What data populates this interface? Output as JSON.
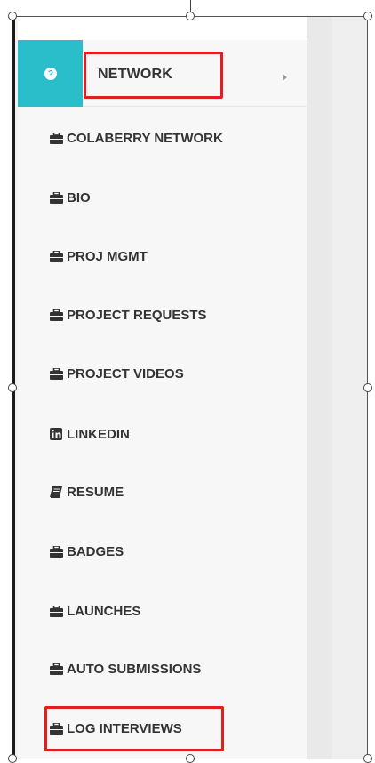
{
  "menu": {
    "header": {
      "label": "NETWORK",
      "icon": "question-circle-icon"
    },
    "items": [
      {
        "label": "COLABERRY NETWORK",
        "icon": "briefcase-icon"
      },
      {
        "label": "BIO",
        "icon": "briefcase-icon"
      },
      {
        "label": "PROJ MGMT",
        "icon": "briefcase-icon"
      },
      {
        "label": "PROJECT REQUESTS",
        "icon": "briefcase-icon"
      },
      {
        "label": "PROJECT VIDEOS",
        "icon": "briefcase-icon"
      },
      {
        "label": "LINKEDIN",
        "icon": "linkedin-icon"
      },
      {
        "label": "RESUME",
        "icon": "book-icon"
      },
      {
        "label": "BADGES",
        "icon": "briefcase-icon"
      },
      {
        "label": "LAUNCHES",
        "icon": "briefcase-icon"
      },
      {
        "label": "AUTO SUBMISSIONS",
        "icon": "briefcase-icon"
      },
      {
        "label": "LOG INTERVIEWS",
        "icon": "briefcase-icon"
      }
    ]
  },
  "colors": {
    "accent": "#29bec9",
    "highlight": "#e02020",
    "text": "#333333"
  }
}
